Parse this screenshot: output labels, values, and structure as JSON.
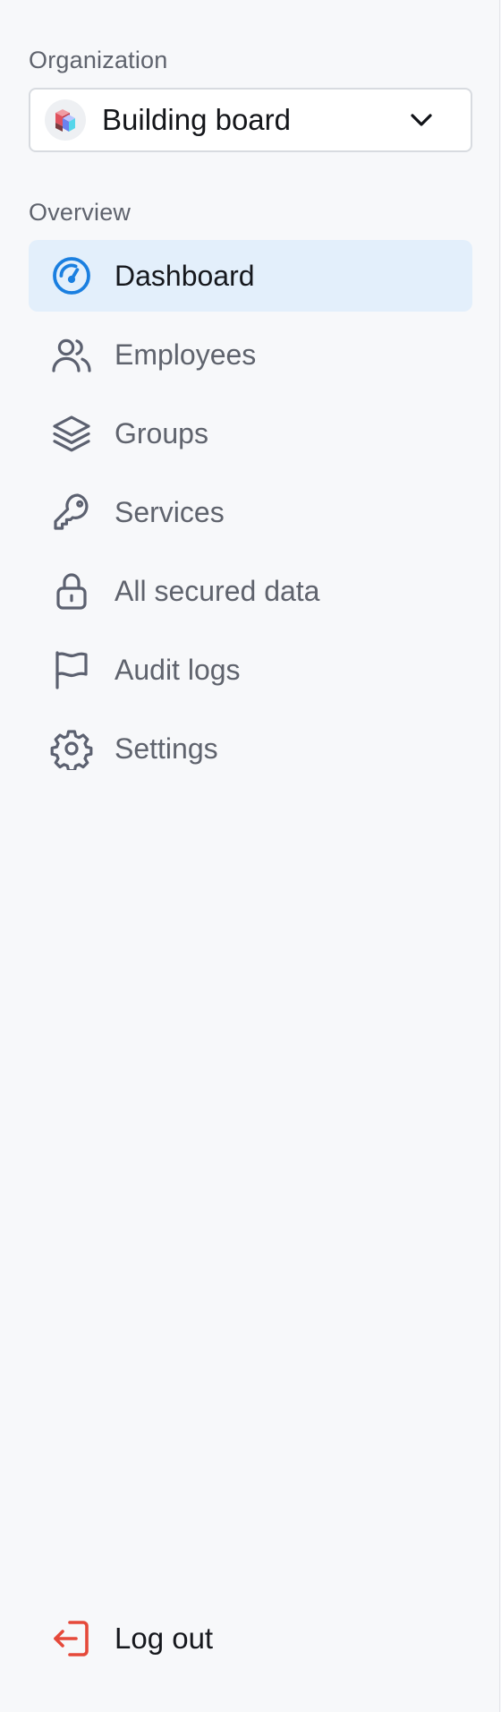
{
  "organization": {
    "section_label": "Organization",
    "selected": "Building board",
    "logo_icon": "building-blocks-logo",
    "dropdown_icon": "chevron-down-icon"
  },
  "overview": {
    "section_label": "Overview",
    "items": [
      {
        "label": "Dashboard",
        "icon": "gauge-icon",
        "active": true
      },
      {
        "label": "Employees",
        "icon": "users-icon",
        "active": false
      },
      {
        "label": "Groups",
        "icon": "layers-icon",
        "active": false
      },
      {
        "label": "Services",
        "icon": "key-icon",
        "active": false
      },
      {
        "label": "All secured data",
        "icon": "lock-icon",
        "active": false
      },
      {
        "label": "Audit logs",
        "icon": "flag-icon",
        "active": false
      },
      {
        "label": "Settings",
        "icon": "gear-icon",
        "active": false
      }
    ]
  },
  "logout": {
    "label": "Log out",
    "icon": "logout-icon"
  },
  "colors": {
    "background": "#f7f8fa",
    "active_bg": "#e3effb",
    "accent_blue": "#1a7fe0",
    "icon_gray": "#5c6170",
    "logout_red": "#e5493a"
  }
}
